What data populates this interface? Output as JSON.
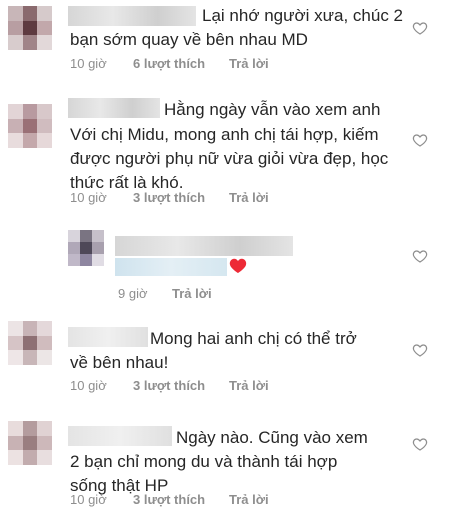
{
  "comments": [
    {
      "text_lines": [
        "Lại nhớ người xưa, chúc 2",
        "bạn sớm quay về bên nhau MD"
      ],
      "time": "10 giờ",
      "likes": "6 lượt thích",
      "reply": "Trả lời"
    },
    {
      "text_lines": [
        "Hằng ngày vẫn vào xem anh",
        "Với chị Midu, mong anh chị tái hợp, kiếm",
        "được người phụ nữ vừa giỏi vừa đẹp, học",
        "thức rất là khó."
      ],
      "time": "10 giờ",
      "likes": "3 lượt thích",
      "reply": "Trả lời"
    },
    {
      "text_lines": [],
      "time": "9 giờ",
      "likes": "",
      "reply": "Trả lời"
    },
    {
      "text_lines": [
        "Mong hai anh chị có thể trở",
        "về bên nhau!"
      ],
      "time": "10 giờ",
      "likes": "3 lượt thích",
      "reply": "Trả lời"
    },
    {
      "text_lines": [
        "Ngày nào. Cũng vào xem",
        "2 bạn chỉ mong du và thành tái hợp",
        "sống thật HP"
      ],
      "time": "10 giờ",
      "likes": "3 lượt thích",
      "reply": "Trả lời"
    }
  ],
  "heart_color": "#ed2a36"
}
